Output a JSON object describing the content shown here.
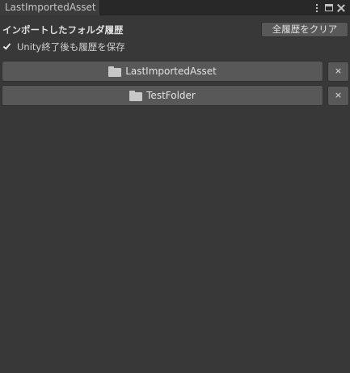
{
  "window": {
    "tab_title": "LastImportedAsset",
    "icons": [
      "more-options-icon",
      "maximize-icon",
      "close-icon"
    ]
  },
  "header": {
    "title": "インポートしたフォルダ履歴",
    "clear_button_label": "全履歴をクリア"
  },
  "options": {
    "keep_history_label": "Unity終了後も履歴を保存",
    "keep_history_checked": true
  },
  "history": [
    {
      "label": "LastImportedAsset",
      "icon": "folder-icon",
      "remove_label": "×"
    },
    {
      "label": "TestFolder",
      "icon": "folder-icon",
      "remove_label": "×"
    }
  ],
  "colors": {
    "background": "#383838",
    "tab_bar": "#282828",
    "button": "#585858",
    "text": "#d2d2d2"
  }
}
